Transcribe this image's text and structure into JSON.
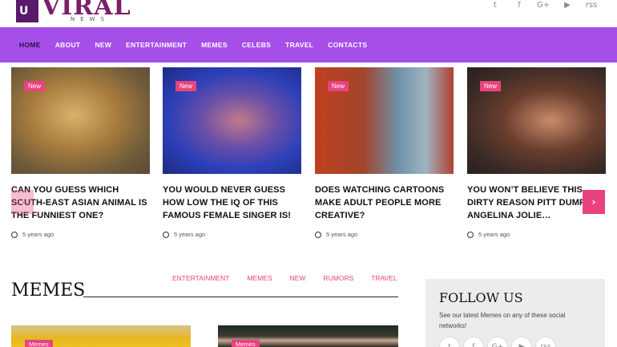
{
  "brand": {
    "logo_mark": "U",
    "logo_text": "VIRAL",
    "logo_sub": "NEWS"
  },
  "social": [
    "t",
    "f",
    "G+",
    "▶",
    "rss"
  ],
  "nav": [
    {
      "label": "HOME",
      "active": true
    },
    {
      "label": "ABOUT"
    },
    {
      "label": "NEW"
    },
    {
      "label": "ENTERTAINMENT"
    },
    {
      "label": "MEMES"
    },
    {
      "label": "CELEBS"
    },
    {
      "label": "TRAVEL"
    },
    {
      "label": "CONTACTS"
    }
  ],
  "slider": {
    "prev_icon": "‹",
    "next_icon": "›",
    "cards": [
      {
        "badge": "New",
        "title": "CAN YOU GUESS WHICH SOUTH-EAST ASIAN ANIMAL IS THE FUNNIEST ONE?",
        "time": "5 years ago"
      },
      {
        "badge": "New",
        "title": "YOU WOULD NEVER GUESS HOW LOW THE IQ OF THIS FAMOUS FEMALE SINGER IS!",
        "time": "5 years ago"
      },
      {
        "badge": "New",
        "title": "DOES WATCHING CARTOONS MAKE ADULT PEOPLE MORE CREATIVE?",
        "time": "5 years ago"
      },
      {
        "badge": "New",
        "title": "YOU WON’T BELIEVE THIS DIRTY REASON PITT DUMPED ANGELINA JOLIE…",
        "time": "5 years ago"
      }
    ]
  },
  "memes_section": {
    "title": "MEMES",
    "tabs": [
      "ENTERTAINMENT",
      "MEMES",
      "NEW",
      "RUMORS",
      "TRAVEL"
    ],
    "cards": [
      {
        "badge": "Memes"
      },
      {
        "badge": "Memes"
      }
    ]
  },
  "follow": {
    "title": "FOLLOW US",
    "text": "See our latest Memes on any of these social networks!",
    "icons": [
      "t",
      "f",
      "G+",
      "▶",
      "rss"
    ]
  },
  "colors": {
    "accent": "#e8437f",
    "nav_bg": "#a54ee8"
  }
}
